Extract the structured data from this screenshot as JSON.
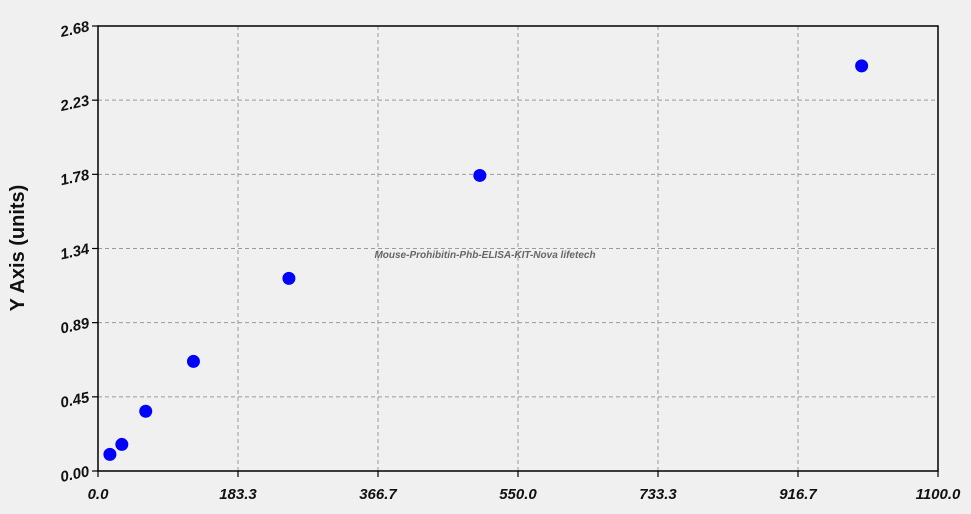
{
  "chart_data": {
    "type": "scatter",
    "title": "",
    "xlabel": "",
    "ylabel": "Y Axis (units)",
    "annotation": "Mouse-Prohibitin-Phb-ELISA-KIT-Nova lifetech",
    "xlim": [
      0,
      1100
    ],
    "ylim": [
      0,
      2.68
    ],
    "xticks": [
      "0.0",
      "183.3",
      "366.7",
      "550.0",
      "733.3",
      "916.7",
      "1100.0"
    ],
    "yticks": [
      "0.00",
      "0.45",
      "0.89",
      "1.34",
      "1.78",
      "2.23",
      "2.68"
    ],
    "grid": true,
    "marker_color": "#0000ff",
    "series": [
      {
        "x": [
          15.6,
          31.2,
          62.5,
          125,
          250,
          500,
          1000
        ],
        "y": [
          0.1,
          0.16,
          0.36,
          0.66,
          1.16,
          1.78,
          2.44
        ]
      }
    ]
  }
}
